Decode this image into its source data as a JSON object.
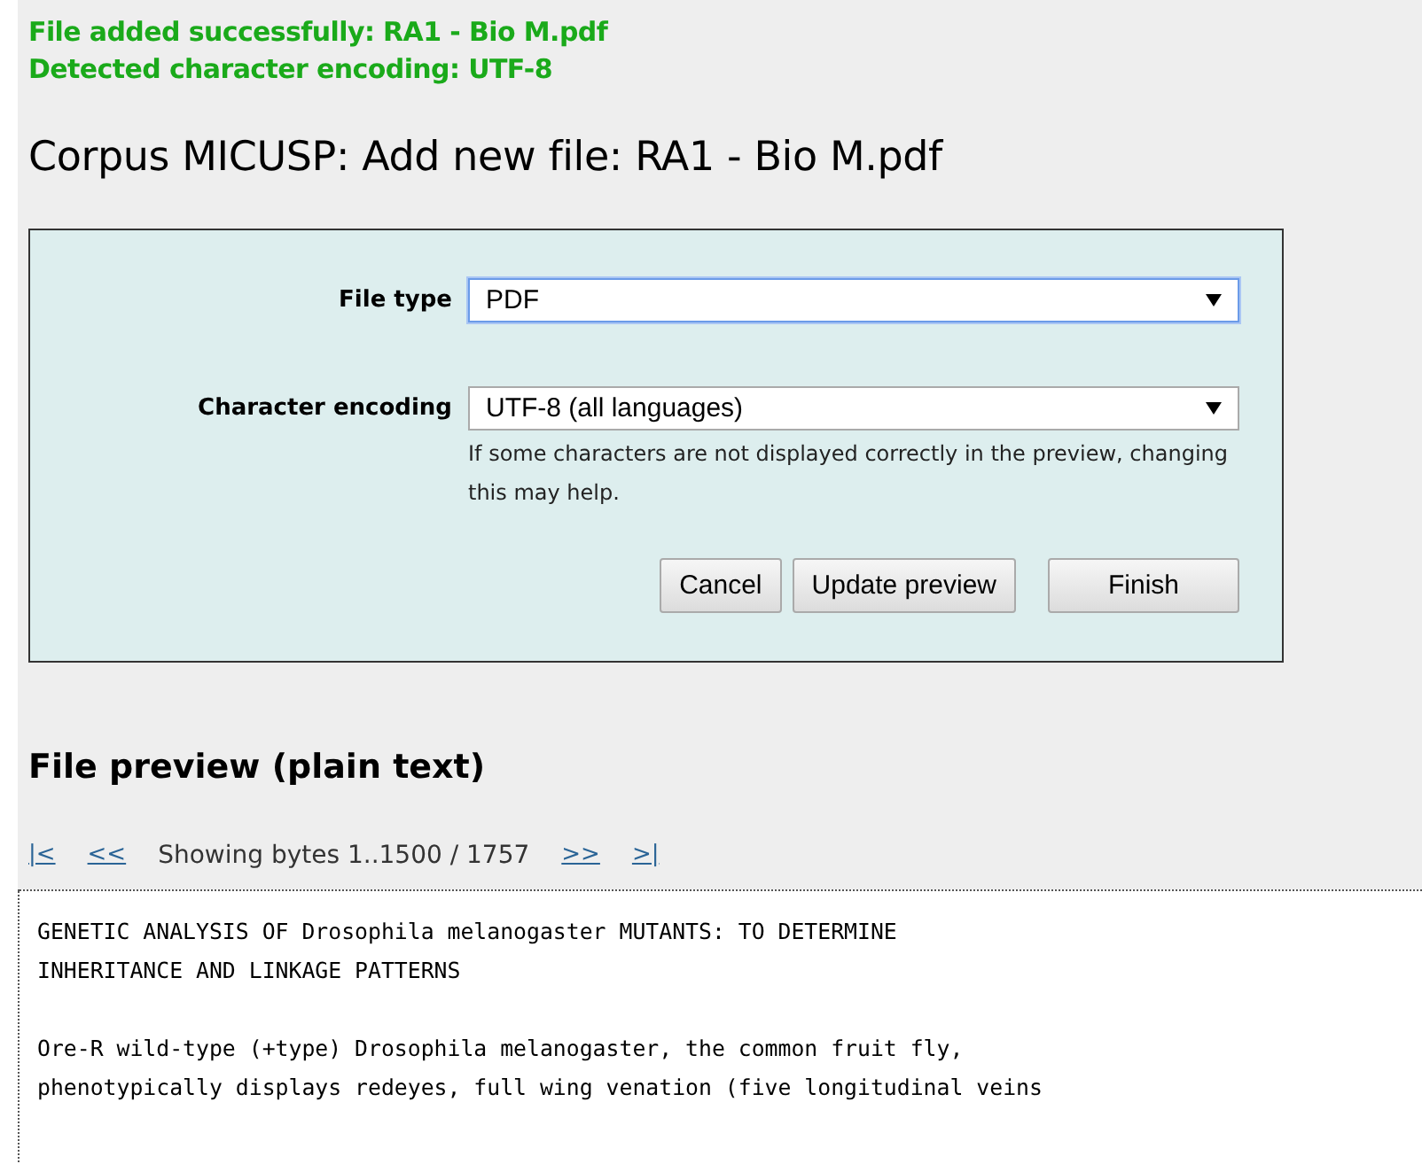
{
  "messages": [
    "File added successfully: RA1 - Bio M.pdf",
    "Detected character encoding: UTF-8"
  ],
  "title": "Corpus MICUSP: Add new file: RA1 - Bio M.pdf",
  "form": {
    "fields": [
      {
        "label": "File type",
        "value": "PDF",
        "focused": true
      },
      {
        "label": "Character encoding",
        "value": "UTF-8 (all languages)",
        "focused": false,
        "help": "If some characters are not displayed correctly in the preview, changing this may help."
      }
    ],
    "buttons": [
      "Cancel",
      "Update preview",
      "Finish"
    ]
  },
  "preview": {
    "heading": "File preview (plain text)",
    "nav": {
      "first": "|<",
      "prev": "<<",
      "status": "Showing bytes 1..1500 / 1757",
      "next": ">>",
      "last": ">|"
    },
    "paragraphs": [
      [
        "GENETIC ANALYSIS OF Drosophila melanogaster MUTANTS: TO DETERMINE",
        "INHERITANCE AND LINKAGE PATTERNS"
      ],
      [
        "Ore-R wild-type (+type) Drosophila melanogaster, the common fruit fly,",
        "phenotypically displays redeyes, full wing venation (five longitudinal veins"
      ]
    ]
  }
}
